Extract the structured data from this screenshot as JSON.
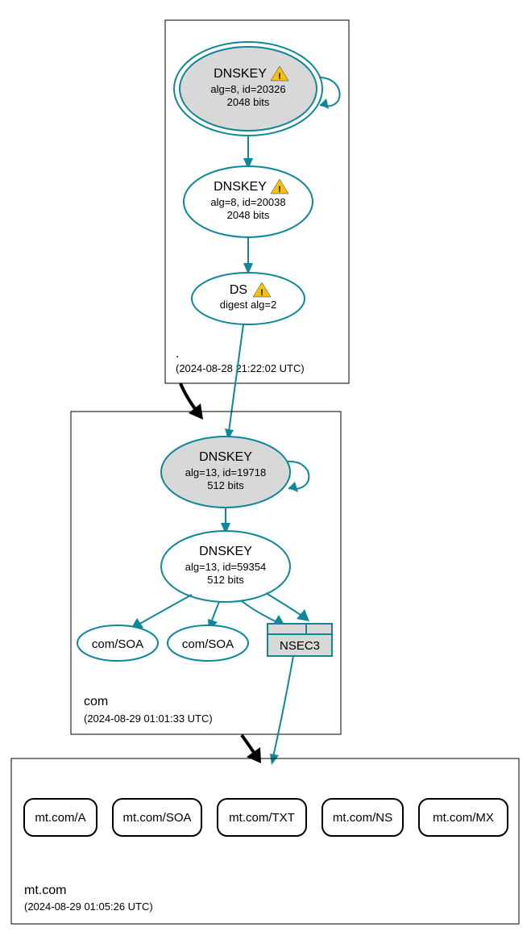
{
  "colors": {
    "teal": "#0d8799",
    "ksk_fill": "#d8d8d8"
  },
  "zones": {
    "root": {
      "label": ".",
      "timestamp": "(2024-08-28 21:22:02 UTC)",
      "nodes": {
        "ksk": {
          "title": "DNSKEY",
          "line2": "alg=8, id=20326",
          "line3": "2048 bits",
          "warning": true
        },
        "zsk": {
          "title": "DNSKEY",
          "line2": "alg=8, id=20038",
          "line3": "2048 bits",
          "warning": true
        },
        "ds": {
          "title": "DS",
          "line2": "digest alg=2",
          "warning": true
        }
      }
    },
    "com": {
      "label": "com",
      "timestamp": "(2024-08-29 01:01:33 UTC)",
      "nodes": {
        "ksk": {
          "title": "DNSKEY",
          "line2": "alg=13, id=19718",
          "line3": "512 bits",
          "warning": false
        },
        "zsk": {
          "title": "DNSKEY",
          "line2": "alg=13, id=59354",
          "line3": "512 bits",
          "warning": false
        },
        "soa1": {
          "label": "com/SOA"
        },
        "soa2": {
          "label": "com/SOA"
        },
        "nsec3": {
          "label": "NSEC3"
        }
      }
    },
    "mt": {
      "label": "mt.com",
      "timestamp": "(2024-08-29 01:05:26 UTC)",
      "records": [
        "mt.com/A",
        "mt.com/SOA",
        "mt.com/TXT",
        "mt.com/NS",
        "mt.com/MX"
      ]
    }
  }
}
